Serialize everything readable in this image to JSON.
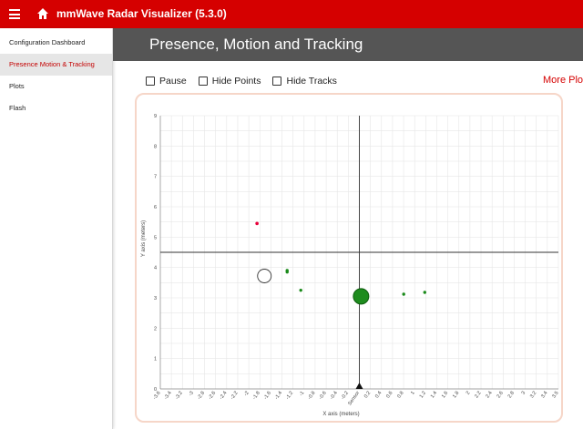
{
  "app": {
    "title": "mmWave Radar Visualizer (5.3.0)"
  },
  "sidebar": {
    "items": [
      {
        "label": "Configuration Dashboard"
      },
      {
        "label": "Presence Motion & Tracking",
        "active": true
      },
      {
        "label": "Plots"
      },
      {
        "label": "Flash"
      }
    ]
  },
  "page": {
    "title": "Presence, Motion and Tracking"
  },
  "controls": {
    "pause": "Pause",
    "hide_points": "Hide Points",
    "hide_tracks": "Hide Tracks",
    "more_plots": "More Plots"
  },
  "colors": {
    "brand": "#d50000",
    "header": "#555555",
    "points": "#1a8a1a",
    "highlight_point": "#e8003a"
  },
  "chart_data": {
    "type": "scatter",
    "xlabel": "X axis (meters)",
    "ylabel": "Y axis (meters)",
    "xlim": [
      -3.5,
      3.5
    ],
    "ylim": [
      0,
      9
    ],
    "x_tick_labels": [
      "-3.6",
      "-3.4",
      "-3.2",
      "-3",
      "-2.8",
      "-2.6",
      "-2.4",
      "-2.2",
      "-2",
      "-1.8",
      "-1.6",
      "-1.4",
      "-1.2",
      "-1",
      "-0.8",
      "-0.6",
      "-0.4",
      "-0.2",
      "Sensor",
      "0.2",
      "0.4",
      "0.6",
      "0.8",
      "1",
      "1.2",
      "1.4",
      "1.6",
      "1.8",
      "2",
      "2.2",
      "2.4",
      "2.6",
      "2.8",
      "3",
      "3.2",
      "3.4",
      "3.5"
    ],
    "y_tick_labels": [
      "0",
      "1",
      "2",
      "3",
      "4",
      "5",
      "6",
      "7",
      "8",
      "9"
    ],
    "boundary_y": 4.5,
    "grid": true,
    "sensor_label": "Sensor",
    "points": [
      {
        "x": -1.27,
        "y": 3.85,
        "kind": "small"
      },
      {
        "x": -1.27,
        "y": 3.9,
        "kind": "small"
      },
      {
        "x": -1.03,
        "y": 3.25,
        "kind": "small"
      },
      {
        "x": 0.03,
        "y": 3.05,
        "kind": "large"
      },
      {
        "x": 0.78,
        "y": 3.12,
        "kind": "small"
      },
      {
        "x": 1.15,
        "y": 3.18,
        "kind": "small"
      },
      {
        "x": -1.8,
        "y": 5.45,
        "kind": "highlight"
      },
      {
        "x": -1.67,
        "y": 3.72,
        "kind": "hollow"
      }
    ]
  }
}
